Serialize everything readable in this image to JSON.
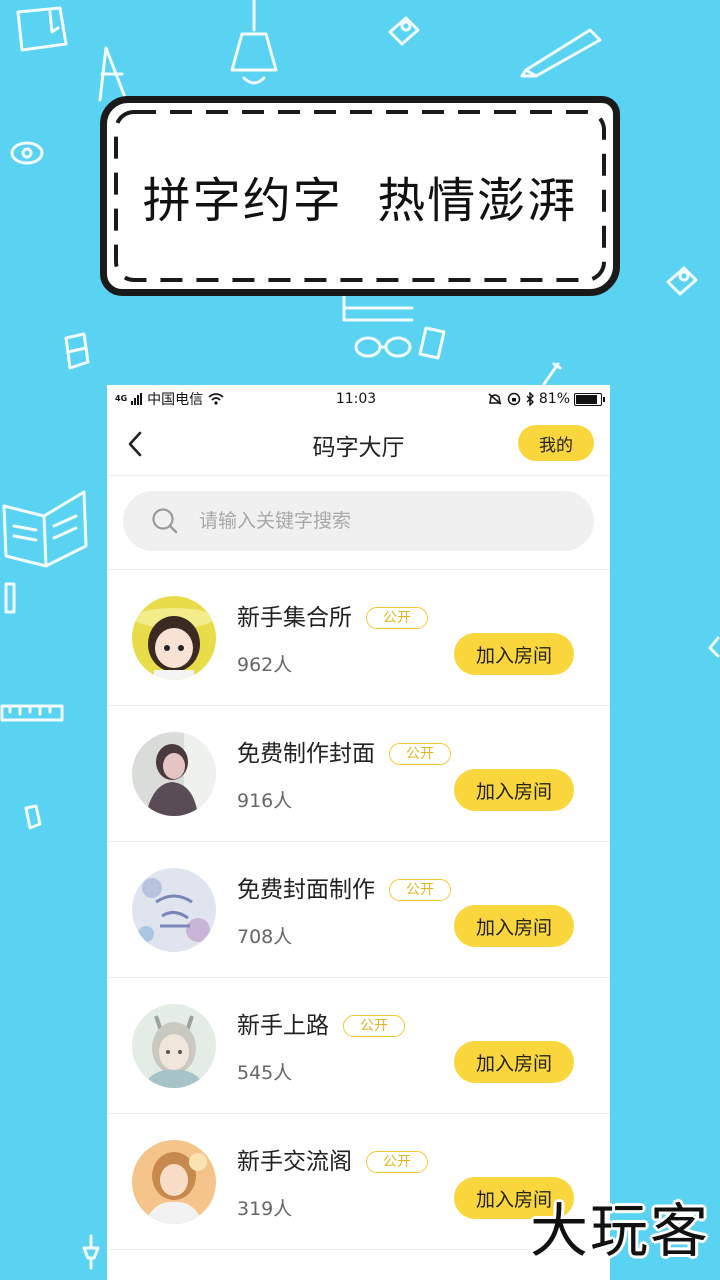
{
  "banner": {
    "title": "拼字约字  热情澎湃"
  },
  "status_bar": {
    "carrier": "中国电信",
    "network": "4G",
    "time": "11:03",
    "battery": "81%"
  },
  "navbar": {
    "back_icon": "chevron-left-icon",
    "title": "码字大厅",
    "mine_label": "我的"
  },
  "search": {
    "placeholder": "请输入关键字搜索",
    "icon": "search-icon"
  },
  "rooms": [
    {
      "name": "新手集合所",
      "badge": "公开",
      "count": "962人",
      "join_label": "加入房间"
    },
    {
      "name": "免费制作封面",
      "badge": "公开",
      "count": "916人",
      "join_label": "加入房间"
    },
    {
      "name": "免费封面制作",
      "badge": "公开",
      "count": "708人",
      "join_label": "加入房间"
    },
    {
      "name": "新手上路",
      "badge": "公开",
      "count": "545人",
      "join_label": "加入房间"
    },
    {
      "name": "新手交流阁",
      "badge": "公开",
      "count": "319人",
      "join_label": "加入房间"
    }
  ],
  "watermark": "大玩客",
  "colors": {
    "background": "#5ad2f2",
    "accent": "#f9d63c",
    "badge": "#f2c836"
  }
}
